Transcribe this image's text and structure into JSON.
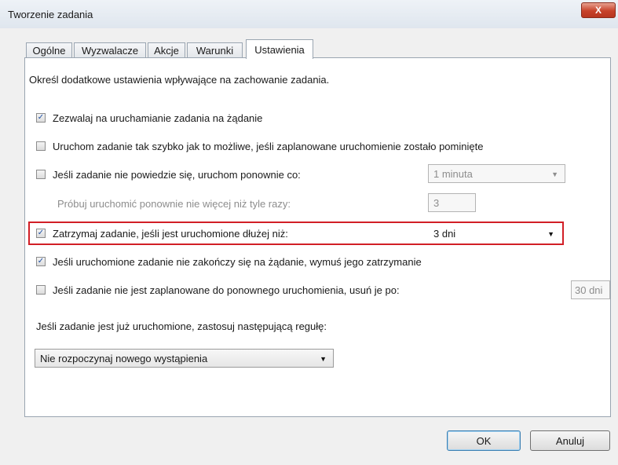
{
  "window": {
    "title": "Tworzenie zadania",
    "close_label": "X"
  },
  "tabs": [
    {
      "label": "Ogólne"
    },
    {
      "label": "Wyzwalacze"
    },
    {
      "label": "Akcje"
    },
    {
      "label": "Warunki"
    },
    {
      "label": "Ustawienia",
      "active": true
    }
  ],
  "settings": {
    "description": "Określ dodatkowe ustawienia wpływające na zachowanie zadania.",
    "allow_on_demand": {
      "label": "Zezwalaj na uruchamianie zadania na żądanie",
      "checked": true
    },
    "run_asap": {
      "label": "Uruchom zadanie tak szybko jak to możliwe, jeśli zaplanowane uruchomienie zostało pominięte",
      "checked": false
    },
    "restart_on_fail": {
      "label": "Jeśli zadanie nie powiedzie się, uruchom ponownie co:",
      "checked": false,
      "value": "1 minuta"
    },
    "retry": {
      "label": "Próbuj uruchomić ponownie nie więcej niż tyle razy:",
      "value": "3"
    },
    "stop_if_longer": {
      "label": "Zatrzymaj zadanie, jeśli jest uruchomione dłużej niż:",
      "checked": true,
      "value": "3 dni"
    },
    "force_stop": {
      "label": "Jeśli uruchomione zadanie nie zakończy się na żądanie, wymuś jego zatrzymanie",
      "checked": true
    },
    "delete_after": {
      "label": "Jeśli zadanie nie jest zaplanowane do ponownego uruchomienia, usuń je po:",
      "checked": false,
      "value": "30 dni"
    },
    "rule_label": "Jeśli zadanie jest już uruchomione, zastosuj następującą regułę:",
    "rule_value": "Nie rozpoczynaj nowego wystąpienia"
  },
  "buttons": {
    "ok": "OK",
    "cancel": "Anuluj"
  },
  "colors": {
    "highlight": "#d21f26",
    "check": "#1d4fa3"
  }
}
